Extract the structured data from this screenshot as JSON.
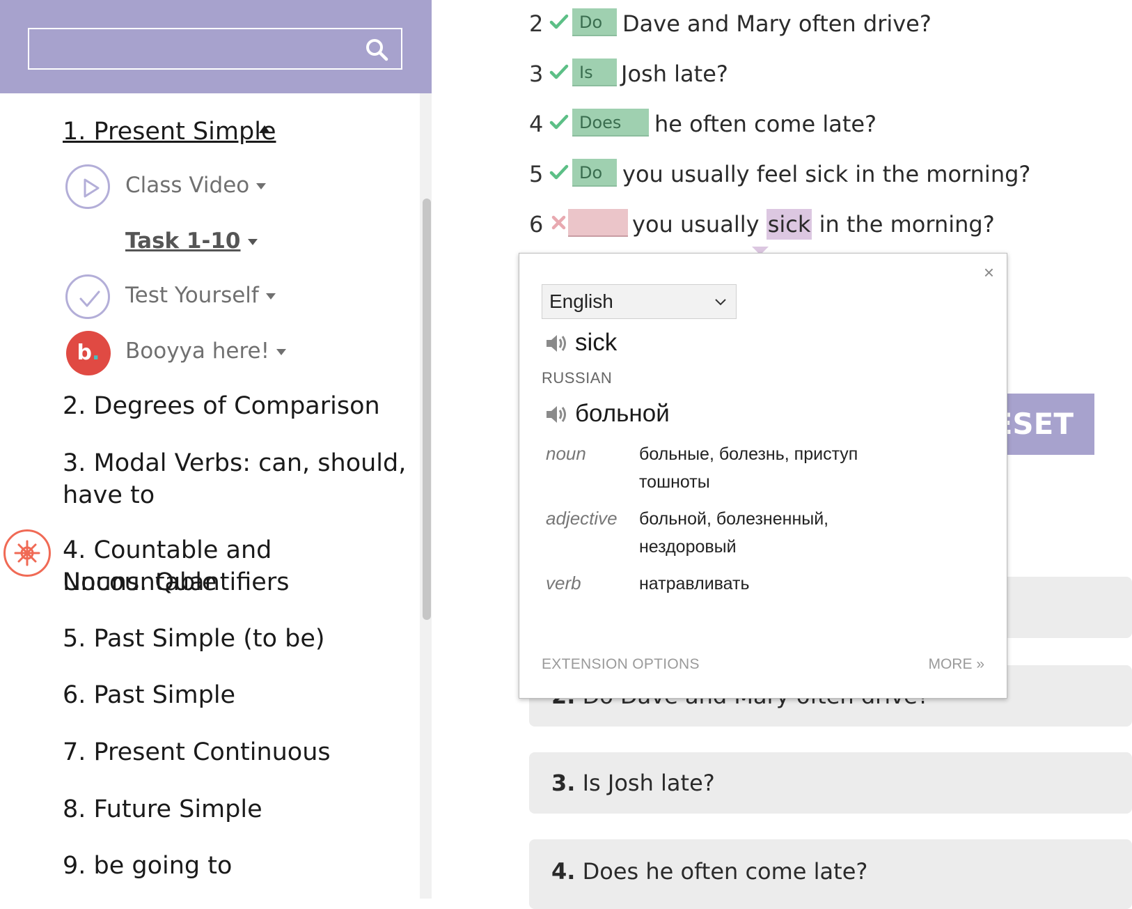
{
  "sidebar": {
    "active_topic": "1. Present Simple",
    "sub_items": [
      {
        "label": "Class Video",
        "icon": "play-icon"
      },
      {
        "label": "Task 1-10"
      },
      {
        "label": "Test Yourself",
        "icon": "check-circle-icon"
      },
      {
        "label": "Booyya here!",
        "icon": "booyya-logo"
      }
    ],
    "booyya_letter": "b",
    "booyya_dot": ".",
    "topics": [
      "2. Degrees of Comparison",
      "3. Modal Verbs: can, should,",
      "have to",
      "4. Countable and Uncountable",
      "Nouns. Quantifiers",
      "5. Past Simple (to be)",
      "6. Past Simple",
      "7. Present Continuous",
      "8. Future Simple",
      "9. be going to"
    ]
  },
  "exercise": {
    "rows": [
      {
        "num": "2",
        "answer": "Do",
        "text": "Dave and Mary often drive?",
        "status": "correct"
      },
      {
        "num": "3",
        "answer": "Is",
        "text": "Josh late?",
        "status": "correct"
      },
      {
        "num": "4",
        "answer": "Does",
        "text": "he often come late?",
        "status": "correct"
      },
      {
        "num": "5",
        "answer": "Do",
        "text": "you usually feel sick in the morning?",
        "status": "correct"
      },
      {
        "num": "6",
        "answer": "",
        "text_before": "you usually ",
        "text_highlight": "sick",
        "text_after": " in the morning?",
        "status": "wrong"
      }
    ],
    "reset_label": "ESET",
    "cards": [
      {
        "num": "2.",
        "text": "Do Dave and Mary often drive?"
      },
      {
        "num": "3.",
        "text": "Is Josh late?"
      },
      {
        "num": "4.",
        "text": "Does he often come late?"
      }
    ]
  },
  "translate_popup": {
    "close": "×",
    "language": "English",
    "source_word": "sick",
    "target_language": "RUSSIAN",
    "translation": "больной",
    "definitions": [
      {
        "pos": "noun",
        "line1": "больные, болезнь, приступ",
        "line2": "тошноты"
      },
      {
        "pos": "adjective",
        "line1": "больной, болезненный,",
        "line2": "нездоровый"
      },
      {
        "pos": "verb",
        "line1": "натравливать",
        "line2": ""
      }
    ],
    "extension_options": "EXTENSION OPTIONS",
    "more": "MORE »"
  },
  "colors": {
    "accent": "#a7a2cd",
    "correct_bg": "#9fd0b0",
    "wrong_bg": "#ebc5c9",
    "highlight": "#dcc7e1",
    "check": "#5cbf86",
    "cross": "#e8a9b0"
  }
}
